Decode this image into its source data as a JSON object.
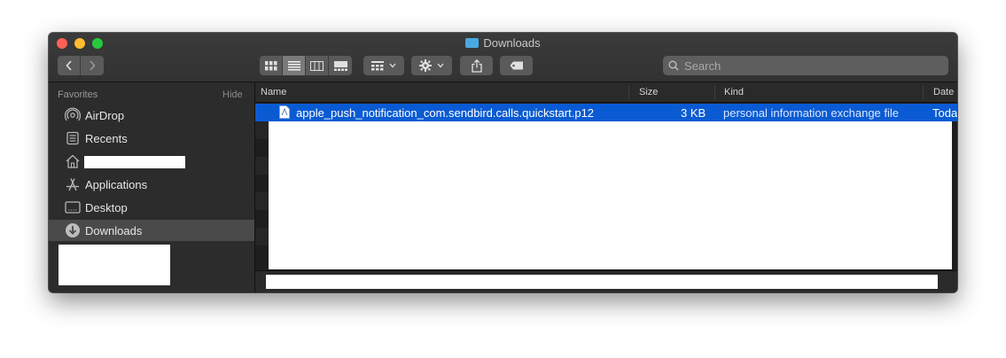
{
  "window": {
    "title": "Downloads",
    "title_icon": "folder-icon"
  },
  "toolbar": {
    "nav": {
      "back_icon": "chevron-left-icon",
      "forward_icon": "chevron-right-icon"
    },
    "view_modes": [
      "icon-view-icon",
      "list-view-icon",
      "column-view-icon",
      "gallery-view-icon"
    ],
    "selected_view": "list-view-icon",
    "group_icon": "group-by-icon",
    "action_icon": "gear-icon",
    "share_icon": "share-icon",
    "tag_icon": "tag-icon",
    "search": {
      "placeholder": "Search",
      "value": ""
    }
  },
  "sidebar": {
    "section_label": "Favorites",
    "hide_label": "Hide",
    "items": [
      {
        "label": "AirDrop",
        "icon": "airdrop-icon"
      },
      {
        "label": "Recents",
        "icon": "recents-icon"
      },
      {
        "label": "",
        "icon": "home-icon"
      },
      {
        "label": "Applications",
        "icon": "applications-icon"
      },
      {
        "label": "Desktop",
        "icon": "desktop-icon"
      },
      {
        "label": "Downloads",
        "icon": "downloads-icon",
        "selected": true
      }
    ]
  },
  "columns": {
    "name": "Name",
    "size": "Size",
    "kind": "Kind",
    "date": "Date"
  },
  "files": [
    {
      "name": "apple_push_notification_com.sendbird.calls.quickstart.p12",
      "size": "3 KB",
      "kind": "personal information exchange file",
      "date": "Toda",
      "selected": true
    }
  ],
  "colors": {
    "selection": "#0a5bd3",
    "sidebar_selected": "#4a4a4a",
    "window_bg": "#1e1e1e"
  }
}
